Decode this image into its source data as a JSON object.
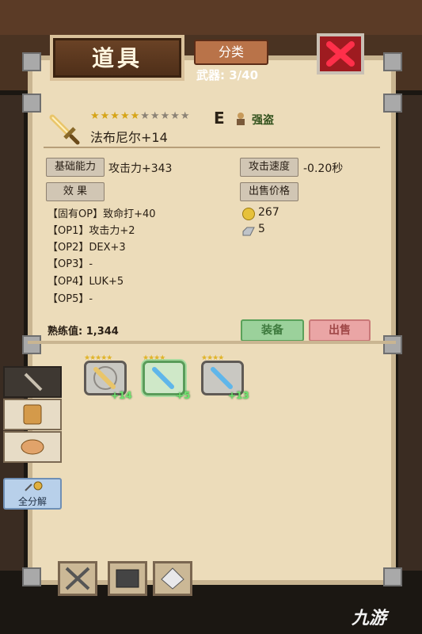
{
  "header": {
    "title": "道具",
    "category_button": "分类",
    "weapon_count": "武器: 3/40"
  },
  "item": {
    "name": "法布尼尔+14",
    "stars_filled": 5,
    "stars_total": 10,
    "rank": "E",
    "job": "强盗",
    "icon": "golden-sword-icon"
  },
  "stats": {
    "base_label": "基础能力",
    "base_value": "攻击力+343",
    "effect_label": "效 果",
    "atk_speed_label": "攻击速度",
    "atk_speed_value": "-0.20秒",
    "sell_label": "出售价格",
    "gold": "267",
    "gem": "5"
  },
  "options": [
    "【固有OP】致命打+40",
    "【OP1】攻击力+2",
    "【OP2】DEX+3",
    "【OP3】-",
    "【OP4】LUK+5",
    "【OP5】-"
  ],
  "mastery": "熟练值: 1,344",
  "actions": {
    "equip": "装备",
    "sell": "出售"
  },
  "inventory": [
    {
      "level": "+14",
      "icon": "golden-sword-icon"
    },
    {
      "level": "+5",
      "icon": "ice-sword-icon"
    },
    {
      "level": "+13",
      "icon": "ice-sword-icon"
    }
  ],
  "side": {
    "disassemble": "全分解"
  },
  "watermark": "九游",
  "colors": {
    "panel": "#ecdcba",
    "equip": "#9bd19b",
    "sell": "#eaa5a5",
    "close": "#9e1b20"
  }
}
